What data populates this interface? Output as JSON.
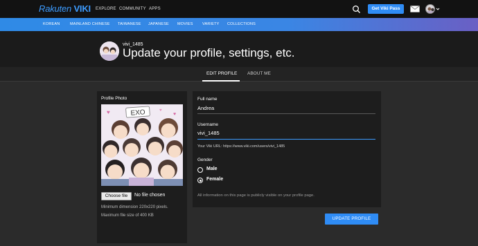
{
  "topbar": {
    "logo_brand": "Rakuten",
    "logo_name": "VIKI",
    "nav": [
      "EXPLORE",
      "COMMUNITY",
      "APPS"
    ],
    "cta_label": "Get Viki Pass"
  },
  "genres": [
    "KOREAN",
    "MAINLAND CHINESE",
    "TAIWANESE",
    "JAPANESE",
    "MOVIES",
    "VARIETY",
    "COLLECTIONS"
  ],
  "header": {
    "username": "vivi_1485",
    "title": "Update your profile, settings, etc."
  },
  "tabs": [
    {
      "label": "EDIT PROFILE",
      "active": true
    },
    {
      "label": "ABOUT ME",
      "active": false
    }
  ],
  "profile_photo": {
    "label": "Profile Photo",
    "artwork_text": "EXO",
    "choose_label": "Choose file",
    "no_file_label": "No file chosen",
    "hint_line1": "Minimum dimension 220x220 pixels.",
    "hint_line2": "Maximum file size of 400 KB"
  },
  "form": {
    "fullname_label": "Full name",
    "fullname_value": "Andrea",
    "username_label": "Username",
    "username_value": "vivi_1485",
    "viki_url": "Your Viki URL: https://www.viki.com/users/vivi_1485",
    "gender_label": "Gender",
    "gender_options": [
      "Male",
      "Female"
    ],
    "gender_selected": "Female",
    "info_text": "All information on this page is publicly visible on your profile page.",
    "submit_label": "UPDATE PROFILE"
  },
  "colors": {
    "accent": "#2f8cf5",
    "topbar_bg": "#121212",
    "page_bg": "#2b2b2b",
    "card_bg": "#1d1d1d"
  }
}
